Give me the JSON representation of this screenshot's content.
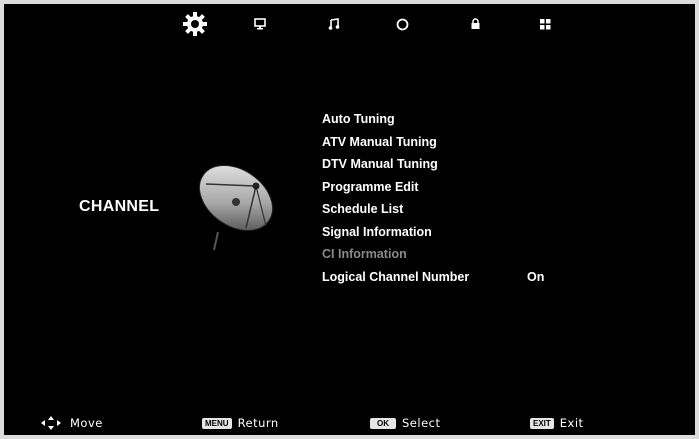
{
  "topbar": {
    "icons": [
      {
        "name": "channel-settings-icon",
        "active": true
      },
      {
        "name": "picture-icon",
        "active": false
      },
      {
        "name": "sound-icon",
        "active": false
      },
      {
        "name": "time-icon",
        "active": false
      },
      {
        "name": "lock-icon",
        "active": false
      },
      {
        "name": "setup-icon",
        "active": false
      }
    ]
  },
  "section": {
    "title": "CHANNEL",
    "image_icon": "satellite-dish-icon"
  },
  "menu": {
    "items": [
      {
        "label": "Auto Tuning",
        "value": "",
        "enabled": true
      },
      {
        "label": "ATV Manual Tuning",
        "value": "",
        "enabled": true
      },
      {
        "label": "DTV Manual Tuning",
        "value": "",
        "enabled": true
      },
      {
        "label": "Programme Edit",
        "value": "",
        "enabled": true
      },
      {
        "label": "Schedule List",
        "value": "",
        "enabled": true
      },
      {
        "label": "Signal Information",
        "value": "",
        "enabled": true
      },
      {
        "label": "CI Information",
        "value": "",
        "enabled": false
      },
      {
        "label": "Logical Channel Number",
        "value": "On",
        "enabled": true
      }
    ]
  },
  "hints": {
    "move": {
      "icon": "arrows-icon",
      "label": "Move"
    },
    "return": {
      "key": "MENU",
      "label": "Return"
    },
    "select": {
      "key": "OK",
      "label": "Select"
    },
    "exit": {
      "key": "EXIT",
      "label": "Exit"
    }
  },
  "colors": {
    "background": "#000000",
    "text": "#ffffff",
    "disabled_text": "#8a8a8a",
    "frame": "#dcdcdc"
  }
}
